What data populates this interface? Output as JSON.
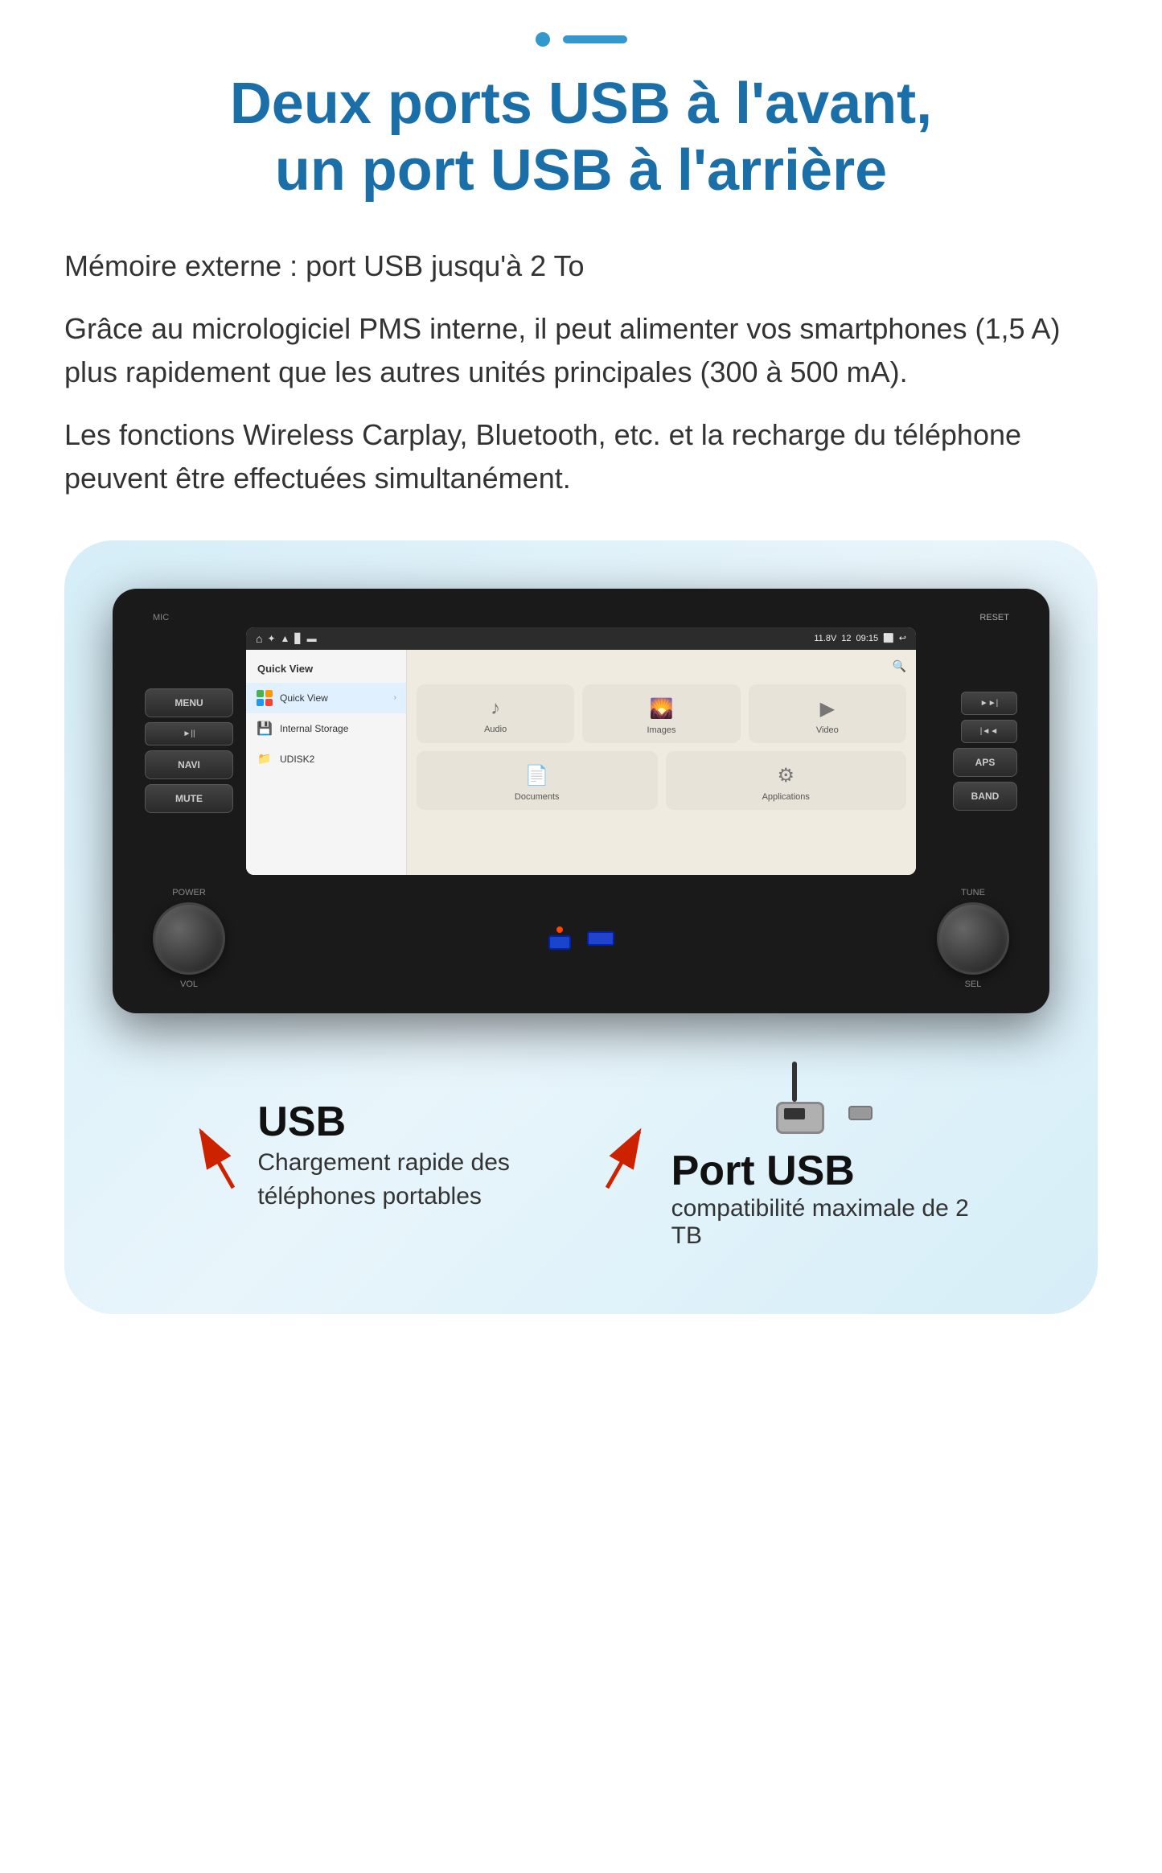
{
  "top_indicator": {
    "dot": "●",
    "dash": "—"
  },
  "heading": {
    "line1": "Deux ports USB à l'avant,",
    "line2": "un port USB à l'arrière"
  },
  "description": {
    "para1": "Mémoire externe : port USB jusqu'à 2 To",
    "para2": "Grâce au micrologiciel PMS interne, il peut alimenter vos smartphones (1,5 A) plus rapidement que les autres unités principales (300 à 500 mA).",
    "para3": "Les fonctions Wireless Carplay, Bluetooth, etc. et la recharge du téléphone peuvent être effectuées simultanément."
  },
  "device": {
    "status_bar": {
      "time": "09:15",
      "battery": "11.8V",
      "volume": "12"
    },
    "sidebar": {
      "title": "Quick View",
      "items": [
        {
          "label": "Quick View",
          "active": true
        },
        {
          "label": "Internal Storage",
          "active": false
        },
        {
          "label": "UDISK2",
          "active": false
        }
      ]
    },
    "grid_items": [
      {
        "label": "Audio",
        "icon": "♪"
      },
      {
        "label": "Images",
        "icon": "⛰"
      },
      {
        "label": "Video",
        "icon": "▶"
      },
      {
        "label": "Documents",
        "icon": "📄"
      },
      {
        "label": "Applications",
        "icon": "⚙"
      }
    ],
    "buttons_left": [
      {
        "label": "MENU"
      },
      {
        "label": "►||"
      },
      {
        "label": "NAVI"
      },
      {
        "label": "MUTE"
      }
    ],
    "buttons_right": [
      {
        "label": "►►|"
      },
      {
        "label": "|◄◄"
      },
      {
        "label": "APS"
      },
      {
        "label": "BAND"
      }
    ],
    "labels": {
      "mic": "MIC",
      "reset": "RESET",
      "power": "POWER",
      "tune": "TUNE",
      "vol": "VOL",
      "sel": "SEL"
    }
  },
  "usb_section": {
    "left": {
      "title": "USB",
      "subtitle_line1": "Chargement rapide des",
      "subtitle_line2": "téléphones portables"
    },
    "right": {
      "title": "Port USB",
      "subtitle_line1": "compatibilité maximale de 2 TB"
    }
  }
}
